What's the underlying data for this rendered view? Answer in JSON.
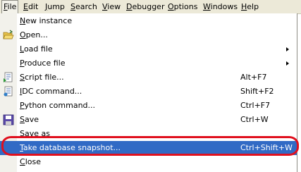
{
  "menubar": {
    "items": [
      {
        "label": "File"
      },
      {
        "label": "Edit"
      },
      {
        "label": "Jump"
      },
      {
        "label": "Search"
      },
      {
        "label": "View"
      },
      {
        "label": "Debugger"
      },
      {
        "label": "Options"
      },
      {
        "label": "Windows"
      },
      {
        "label": "Help"
      }
    ]
  },
  "file_menu": {
    "items": [
      {
        "label": "New instance",
        "shortcut": ""
      },
      {
        "label": "Open...",
        "shortcut": "",
        "icon": "open-folder-icon"
      },
      {
        "label": "Load file",
        "shortcut": "",
        "submenu": true
      },
      {
        "label": "Produce file",
        "shortcut": "",
        "submenu": true
      },
      {
        "label": "Script file...",
        "shortcut": "Alt+F7",
        "icon": "script-file-icon"
      },
      {
        "label": "IDC command...",
        "shortcut": "Shift+F2",
        "icon": "idc-command-icon"
      },
      {
        "label": "Python command...",
        "shortcut": "Ctrl+F7"
      },
      {
        "label": "Save",
        "shortcut": "Ctrl+W",
        "icon": "save-disk-icon"
      },
      {
        "label": "Save as",
        "shortcut": ""
      },
      {
        "label": "Take database snapshot...",
        "shortcut": "Ctrl+Shift+W",
        "selected": true
      },
      {
        "label": "Close",
        "shortcut": ""
      }
    ]
  },
  "colors": {
    "selection": "#316ac5",
    "annotation": "#e0101e"
  }
}
